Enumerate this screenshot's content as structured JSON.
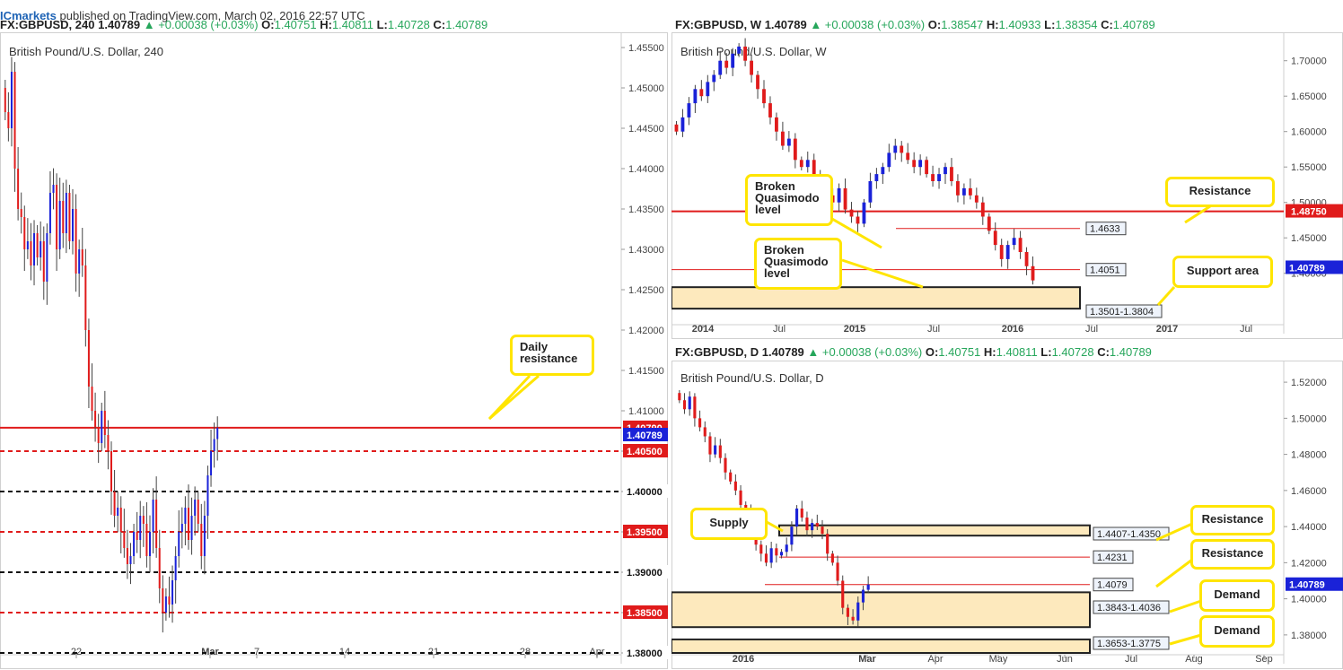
{
  "header_left": {
    "brand": "ICmarkets",
    "published": "published on TradingView.com, March 02, 2016 22:57 UTC",
    "symbol": "FX:GBPUSD, 240",
    "last": "1.40789",
    "change": "▲ +0.00038 (+0.03%)",
    "o_label": "O:",
    "o": "1.40751",
    "h_label": "H:",
    "h": "1.40811",
    "l_label": "L:",
    "l": "1.40728",
    "c_label": "C:",
    "c": "1.40789"
  },
  "header_right_top": {
    "symbol": "FX:GBPUSD, W",
    "last": "1.40789",
    "change": "▲ +0.00038 (+0.03%)",
    "o_label": "O:",
    "o": "1.38547",
    "h_label": "H:",
    "h": "1.40933",
    "l_label": "L:",
    "l": "1.38354",
    "c_label": "C:",
    "c": "1.40789"
  },
  "header_right_bottom": {
    "symbol": "FX:GBPUSD, D",
    "last": "1.40789",
    "change": "▲ +0.00038 (+0.03%)",
    "o_label": "O:",
    "o": "1.40751",
    "h_label": "H:",
    "h": "1.40811",
    "l_label": "L:",
    "l": "1.40728",
    "c_label": "C:",
    "c": "1.40789"
  },
  "colors": {
    "bull": "#1a22d8",
    "bear": "#e01b1b",
    "resistance": "#e01b1b",
    "callout": "#ffe500",
    "zone": "#fde9bd",
    "last_price": "#1a22d8"
  },
  "chart_data": [
    {
      "type": "candlestick",
      "title": "British Pound/U.S. Dollar, 240",
      "ylim": [
        1.38,
        1.456
      ],
      "ticks_y": [
        "1.45500",
        "1.45000",
        "1.44500",
        "1.44000",
        "1.43500",
        "1.43000",
        "1.42500",
        "1.42000",
        "1.41500",
        "1.41000",
        "1.40500",
        "1.40000",
        "1.39500",
        "1.39000",
        "1.38500",
        "1.38000"
      ],
      "ticks_x": [
        "22",
        "Mar",
        "7",
        "14",
        "21",
        "28",
        "Apr"
      ],
      "horizontal_levels": [
        {
          "value": 1.4079,
          "label": "1.40790",
          "style": "solid"
        },
        {
          "value": 1.405,
          "label": "1.40500",
          "style": "dashed-red"
        },
        {
          "value": 1.4,
          "label": "1.40000",
          "style": "dashed-black"
        },
        {
          "value": 1.395,
          "label": "1.39500",
          "style": "dashed-red"
        },
        {
          "value": 1.39,
          "label": "1.39000",
          "style": "dashed-black"
        },
        {
          "value": 1.385,
          "label": "1.38500",
          "style": "dashed-red"
        },
        {
          "value": 1.38,
          "label": "1.38000",
          "style": "dashed-black"
        }
      ],
      "last_price": {
        "value": 1.40789,
        "label": "1.40789"
      },
      "annotations": [
        {
          "text": "Daily resistance"
        }
      ],
      "close_path": [
        1.447,
        1.445,
        1.452,
        1.44,
        1.435,
        1.434,
        1.43,
        1.431,
        1.428,
        1.432,
        1.429,
        1.431,
        1.426,
        1.432,
        1.437,
        1.438,
        1.43,
        1.436,
        1.432,
        1.437,
        1.431,
        1.435,
        1.427,
        1.43,
        1.428,
        1.42,
        1.413,
        1.41,
        1.408,
        1.406,
        1.41,
        1.407,
        1.405,
        1.4,
        1.397,
        1.398,
        1.395,
        1.393,
        1.391,
        1.392,
        1.395,
        1.394,
        1.397,
        1.396,
        1.392,
        1.395,
        1.399,
        1.393,
        1.388,
        1.385,
        1.387,
        1.386,
        1.389,
        1.392,
        1.395,
        1.396,
        1.398,
        1.394,
        1.397,
        1.399,
        1.396,
        1.392,
        1.397,
        1.402,
        1.405,
        1.4065,
        1.4079
      ]
    },
    {
      "type": "candlestick",
      "title": "British Pound/U.S. Dollar, W",
      "ylim": [
        1.33,
        1.73
      ],
      "ticks_y": [
        "1.70000",
        "1.65000",
        "1.60000",
        "1.55000",
        "1.50000",
        "1.45000",
        "1.40000"
      ],
      "ticks_x": [
        "2014",
        "Jul",
        "2015",
        "Jul",
        "2016",
        "Jul",
        "2017",
        "Jul"
      ],
      "levels": [
        {
          "value": 1.4875,
          "label": "1.48750",
          "name": "Resistance"
        },
        {
          "value": 1.4633,
          "label": "1.4633",
          "name": "Broken Quasimodo level"
        },
        {
          "value": 1.4051,
          "label": "1.4051",
          "name": "Broken Quasimodo level"
        }
      ],
      "zones": [
        {
          "label": "1.3501-1.3804",
          "low": 1.3501,
          "high": 1.3804,
          "name": "Support area"
        }
      ],
      "last_price": {
        "value": 1.40789,
        "label": "1.40789"
      },
      "annotations": [
        {
          "text": "Broken Quasimodo level"
        },
        {
          "text": "Broken Quasimodo level"
        },
        {
          "text": "Resistance"
        },
        {
          "text": "Support area"
        }
      ],
      "close_path": [
        1.6,
        1.62,
        1.64,
        1.66,
        1.65,
        1.67,
        1.68,
        1.7,
        1.69,
        1.71,
        1.72,
        1.7,
        1.68,
        1.66,
        1.64,
        1.62,
        1.6,
        1.58,
        1.59,
        1.56,
        1.55,
        1.56,
        1.54,
        1.52,
        1.51,
        1.5,
        1.52,
        1.49,
        1.48,
        1.47,
        1.5,
        1.53,
        1.54,
        1.55,
        1.57,
        1.58,
        1.57,
        1.56,
        1.55,
        1.56,
        1.54,
        1.53,
        1.54,
        1.55,
        1.53,
        1.51,
        1.52,
        1.51,
        1.5,
        1.48,
        1.46,
        1.44,
        1.42,
        1.44,
        1.45,
        1.43,
        1.41,
        1.39
      ]
    },
    {
      "type": "candlestick",
      "title": "British Pound/U.S. Dollar, D",
      "ylim": [
        1.37,
        1.528
      ],
      "ticks_y": [
        "1.52000",
        "1.50000",
        "1.48000",
        "1.46000",
        "1.44000",
        "1.42000",
        "1.40000",
        "1.38000"
      ],
      "ticks_x": [
        "2016",
        "Mar",
        "Apr",
        "May",
        "Jun",
        "Jul",
        "Aug",
        "Sep"
      ],
      "levels": [
        {
          "value": 1.4231,
          "label": "1.4231",
          "name": "Resistance"
        },
        {
          "value": 1.4079,
          "label": "1.4079",
          "name": "Resistance"
        }
      ],
      "zones": [
        {
          "label": "1.4407-1.4350",
          "low": 1.435,
          "high": 1.4407,
          "name": "Supply"
        },
        {
          "label": "1.3843-1.4036",
          "low": 1.3843,
          "high": 1.4036,
          "name": "Demand"
        },
        {
          "label": "1.3653-1.3775",
          "low": 1.3653,
          "high": 1.3775,
          "name": "Demand"
        }
      ],
      "last_price": {
        "value": 1.40789,
        "label": "1.40789"
      },
      "annotations": [
        {
          "text": "Supply"
        },
        {
          "text": "Resistance"
        },
        {
          "text": "Resistance"
        },
        {
          "text": "Demand"
        },
        {
          "text": "Demand"
        }
      ],
      "close_path": [
        1.51,
        1.505,
        1.512,
        1.5,
        1.495,
        1.49,
        1.48,
        1.485,
        1.478,
        1.47,
        1.465,
        1.46,
        1.452,
        1.448,
        1.44,
        1.43,
        1.425,
        1.42,
        1.428,
        1.424,
        1.426,
        1.43,
        1.44,
        1.45,
        1.445,
        1.438,
        1.442,
        1.44,
        1.436,
        1.425,
        1.42,
        1.41,
        1.395,
        1.39,
        1.388,
        1.398,
        1.405,
        1.4079
      ]
    }
  ]
}
